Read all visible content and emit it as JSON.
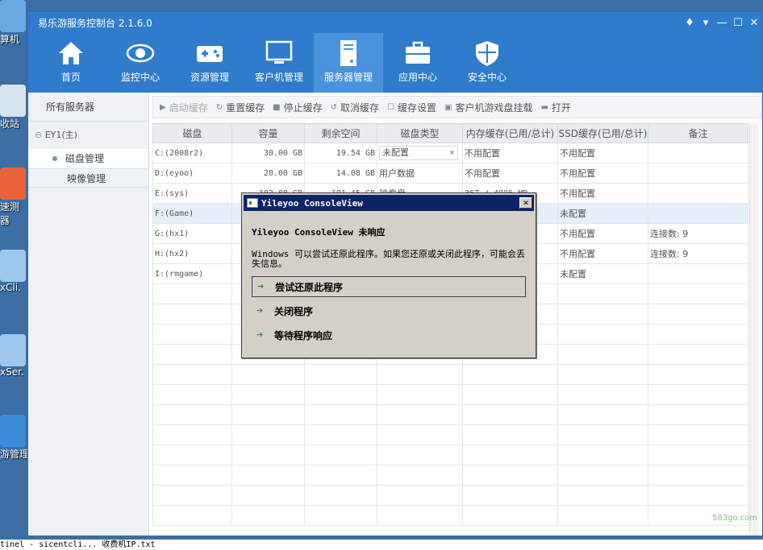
{
  "desktop": {
    "icons": [
      {
        "label": "算机",
        "icon": "computer-icon"
      },
      {
        "label": "收站",
        "icon": "recycle-bin-icon"
      },
      {
        "label": "速测\n器",
        "icon": "speedtest-icon"
      },
      {
        "label": "xCli.",
        "icon": "disc-icon"
      },
      {
        "label": "xSer.",
        "icon": "disc-icon"
      },
      {
        "label": "游管理",
        "icon": "monitor-icon"
      }
    ],
    "taskbar_text": "tinel - sicentcli...  收费机IP.txt"
  },
  "window": {
    "title": "易乐游服务控制台 2.1.6.0",
    "controls": [
      "♦",
      "▾",
      "—",
      "☐",
      "✕"
    ]
  },
  "nav": [
    {
      "label": "首页",
      "icon": "home-icon",
      "active": false
    },
    {
      "label": "监控中心",
      "icon": "eye-icon",
      "active": false
    },
    {
      "label": "资源管理",
      "icon": "gamepad-icon",
      "active": false
    },
    {
      "label": "客户机管理",
      "icon": "monitor-icon",
      "active": false
    },
    {
      "label": "服务器管理",
      "icon": "server-icon",
      "active": true
    },
    {
      "label": "应用中心",
      "icon": "toolbox-icon",
      "active": false
    },
    {
      "label": "安全中心",
      "icon": "shield-icon",
      "active": false
    }
  ],
  "sidebar": {
    "header": "所有服务器",
    "server": "EY1(主)",
    "items": [
      "磁盘管理",
      "映像管理"
    ]
  },
  "toolbar": [
    {
      "label": "启动缓存",
      "icon": "play-icon",
      "disabled": true
    },
    {
      "label": "重置缓存",
      "icon": "reset-icon",
      "disabled": false
    },
    {
      "label": "停止缓存",
      "icon": "stop-icon",
      "disabled": false
    },
    {
      "label": "取消缓存",
      "icon": "cancel-icon",
      "disabled": false
    },
    {
      "label": "缓存设置",
      "icon": "checkbox-icon",
      "disabled": false
    },
    {
      "label": "客户机游戏盘挂载",
      "icon": "mount-icon",
      "disabled": false
    },
    {
      "label": "打开",
      "icon": "folder-icon",
      "disabled": false
    }
  ],
  "table": {
    "columns": [
      "磁盘",
      "容量",
      "剩余空间",
      "磁盘类型",
      "内存缓存(已用/总计)",
      "SSD缓存(已用/总计)",
      "备注"
    ],
    "rows": [
      [
        "C:(2008r2)",
        "30.00 GB",
        "19.54 GB",
        "未配置",
        "不用配置",
        "不用配置",
        ""
      ],
      [
        "D:(eyoo)",
        "20.00 GB",
        "14.08 GB",
        "用户数据",
        "不用配置",
        "不用配置",
        ""
      ],
      [
        "E:(sys)",
        "182.88 GB",
        "101.45 GB",
        "映像盘",
        "367 / 4096 MB",
        "不用配置",
        ""
      ],
      [
        "F:(Game)",
        "",
        "",
        "",
        "",
        "未配置",
        ""
      ],
      [
        "G:(hx1)",
        "",
        "",
        "",
        "",
        "不用配置",
        "连接数: 9"
      ],
      [
        "H:(hx2)",
        "",
        "",
        "",
        "",
        "不用配置",
        "连接数: 9"
      ],
      [
        "I:(rmgame)",
        "",
        "",
        "",
        "",
        "未配置",
        ""
      ]
    ],
    "empty_rows": 12
  },
  "dialog": {
    "title": "Yileyoo ConsoleView",
    "heading": "Yileyoo ConsoleView 未响应",
    "message": "Windows 可以尝试还原此程序。如果您还原或关闭此程序，可能会丢失信息。",
    "options": [
      "尝试还原此程序",
      "关闭程序",
      "等待程序响应"
    ],
    "close": "✕"
  },
  "watermark": "583go.com",
  "colors": {
    "accent": "#2f7ccd",
    "active_nav": "#4b92dd",
    "dialog_title": "#0a246a"
  }
}
